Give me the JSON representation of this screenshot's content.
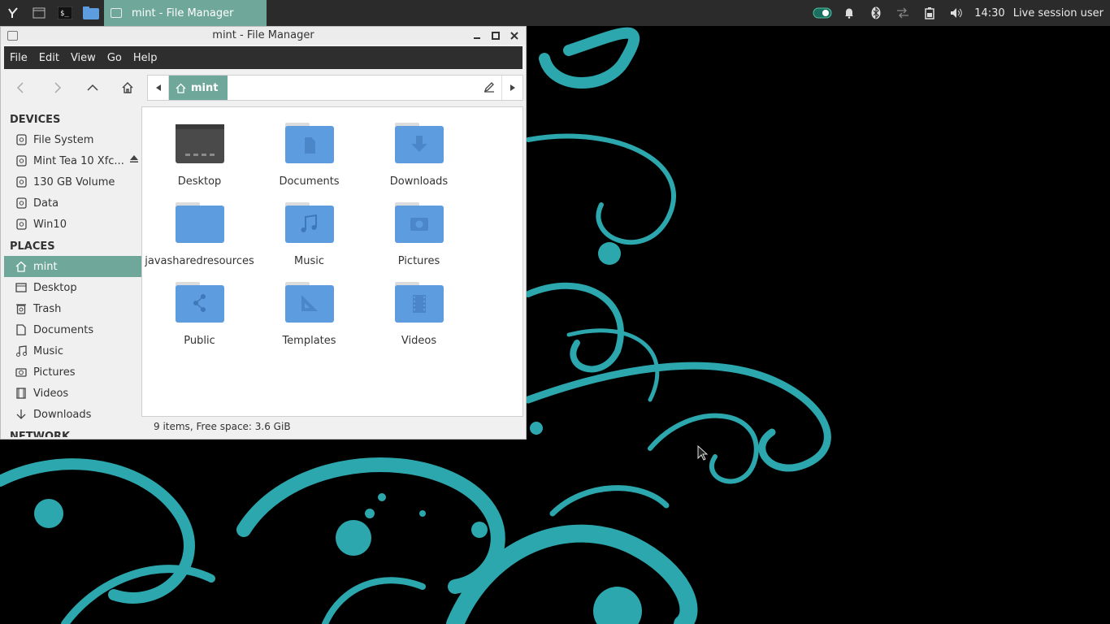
{
  "panel": {
    "task_title": "mint - File Manager",
    "clock": "14:30",
    "user": "Live session user"
  },
  "window": {
    "title": "mint - File Manager"
  },
  "menu": [
    "File",
    "Edit",
    "View",
    "Go",
    "Help"
  ],
  "path": {
    "crumb": "mint"
  },
  "sidebar": {
    "devices_header": "DEVICES",
    "devices": [
      {
        "label": "File System"
      },
      {
        "label": "Mint Tea 10 Xfc..."
      },
      {
        "label": "130 GB Volume"
      },
      {
        "label": "Data"
      },
      {
        "label": "Win10"
      }
    ],
    "places_header": "PLACES",
    "places": [
      {
        "label": "mint"
      },
      {
        "label": "Desktop"
      },
      {
        "label": "Trash"
      },
      {
        "label": "Documents"
      },
      {
        "label": "Music"
      },
      {
        "label": "Pictures"
      },
      {
        "label": "Videos"
      },
      {
        "label": "Downloads"
      }
    ],
    "network_header": "NETWORK"
  },
  "files": [
    {
      "label": "Desktop",
      "icon": "desktop-folder-icon"
    },
    {
      "label": "Documents",
      "icon": "documents-folder-icon"
    },
    {
      "label": "Downloads",
      "icon": "downloads-folder-icon"
    },
    {
      "label": "javasharedresources",
      "icon": "folder-icon"
    },
    {
      "label": "Music",
      "icon": "music-folder-icon"
    },
    {
      "label": "Pictures",
      "icon": "pictures-folder-icon"
    },
    {
      "label": "Public",
      "icon": "public-folder-icon"
    },
    {
      "label": "Templates",
      "icon": "templates-folder-icon"
    },
    {
      "label": "Videos",
      "icon": "videos-folder-icon"
    }
  ],
  "status": "9 items, Free space: 3.6 GiB",
  "colors": {
    "accent": "#6fa89a",
    "folder": "#5e9ce0",
    "wallpaper_swirl": "#2ba7ad"
  }
}
